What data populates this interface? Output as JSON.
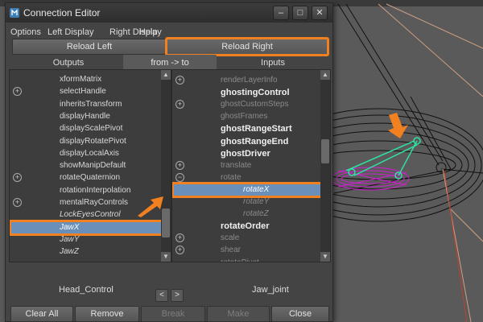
{
  "window": {
    "title": "Connection Editor",
    "minimize_icon": "minimize-icon",
    "maximize_icon": "maximize-icon",
    "close_icon": "close-icon",
    "minimize_glyph": "–",
    "maximize_glyph": "□",
    "close_glyph": "✕"
  },
  "menu": [
    "Options",
    "Left Display",
    "Right Display",
    "Help"
  ],
  "buttons": {
    "reload_left": "Reload Left",
    "reload_right": "Reload Right"
  },
  "tabs": {
    "outputs": "Outputs",
    "direction": "from -> to",
    "inputs": "Inputs"
  },
  "left_list": {
    "items": [
      {
        "label": "xformMatrix",
        "expander": false,
        "style": "normal"
      },
      {
        "label": "selectHandle",
        "expander": true,
        "style": "normal"
      },
      {
        "label": "inheritsTransform",
        "expander": false,
        "style": "normal"
      },
      {
        "label": "displayHandle",
        "expander": false,
        "style": "normal"
      },
      {
        "label": "displayScalePivot",
        "expander": false,
        "style": "normal"
      },
      {
        "label": "displayRotatePivot",
        "expander": false,
        "style": "normal"
      },
      {
        "label": "displayLocalAxis",
        "expander": false,
        "style": "normal"
      },
      {
        "label": "showManipDefault",
        "expander": false,
        "style": "normal"
      },
      {
        "label": "rotateQuaternion",
        "expander": true,
        "style": "normal"
      },
      {
        "label": "rotationInterpolation",
        "expander": false,
        "style": "normal"
      },
      {
        "label": "mentalRayControls",
        "expander": true,
        "style": "normal"
      },
      {
        "label": "LockEyesControl",
        "expander": false,
        "style": "italic"
      },
      {
        "label": "JawX",
        "expander": false,
        "style": "italic",
        "selected": true
      },
      {
        "label": "JawY",
        "expander": false,
        "style": "italic"
      },
      {
        "label": "JawZ",
        "expander": false,
        "style": "italic"
      }
    ]
  },
  "right_list": {
    "items": [
      {
        "label": "renderLayerInfo",
        "expander": true,
        "style": "dim"
      },
      {
        "label": "ghostingControl",
        "expander": false,
        "style": "bold"
      },
      {
        "label": "ghostCustomSteps",
        "expander": true,
        "style": "dim"
      },
      {
        "label": "ghostFrames",
        "expander": false,
        "style": "dim"
      },
      {
        "label": "ghostRangeStart",
        "expander": false,
        "style": "bold"
      },
      {
        "label": "ghostRangeEnd",
        "expander": false,
        "style": "bold"
      },
      {
        "label": "ghostDriver",
        "expander": false,
        "style": "bold"
      },
      {
        "label": "translate",
        "expander": true,
        "style": "dim"
      },
      {
        "label": "rotate",
        "expander": true,
        "style": "dim",
        "expander_glyph": "⊖"
      },
      {
        "label": "rotateX",
        "expander": false,
        "style": "italic",
        "selected": true,
        "indent": 2
      },
      {
        "label": "rotateY",
        "expander": false,
        "style": "dim-italic",
        "indent": 2
      },
      {
        "label": "rotateZ",
        "expander": false,
        "style": "dim-italic",
        "indent": 2
      },
      {
        "label": "rotateOrder",
        "expander": false,
        "style": "bold"
      },
      {
        "label": "scale",
        "expander": true,
        "style": "dim"
      },
      {
        "label": "shear",
        "expander": true,
        "style": "dim"
      },
      {
        "label": "rotatePivot",
        "expander": false,
        "style": "dim"
      }
    ]
  },
  "footer": {
    "left_node": "Head_Control",
    "right_node": "Jaw_joint",
    "prev": "<",
    "next": ">"
  },
  "actions": {
    "clear_all": "Clear All",
    "remove": "Remove",
    "break": "Break",
    "make": "Make",
    "close": "Close"
  },
  "colors": {
    "highlight": "#f08020",
    "selection": "#6a8fb8"
  }
}
